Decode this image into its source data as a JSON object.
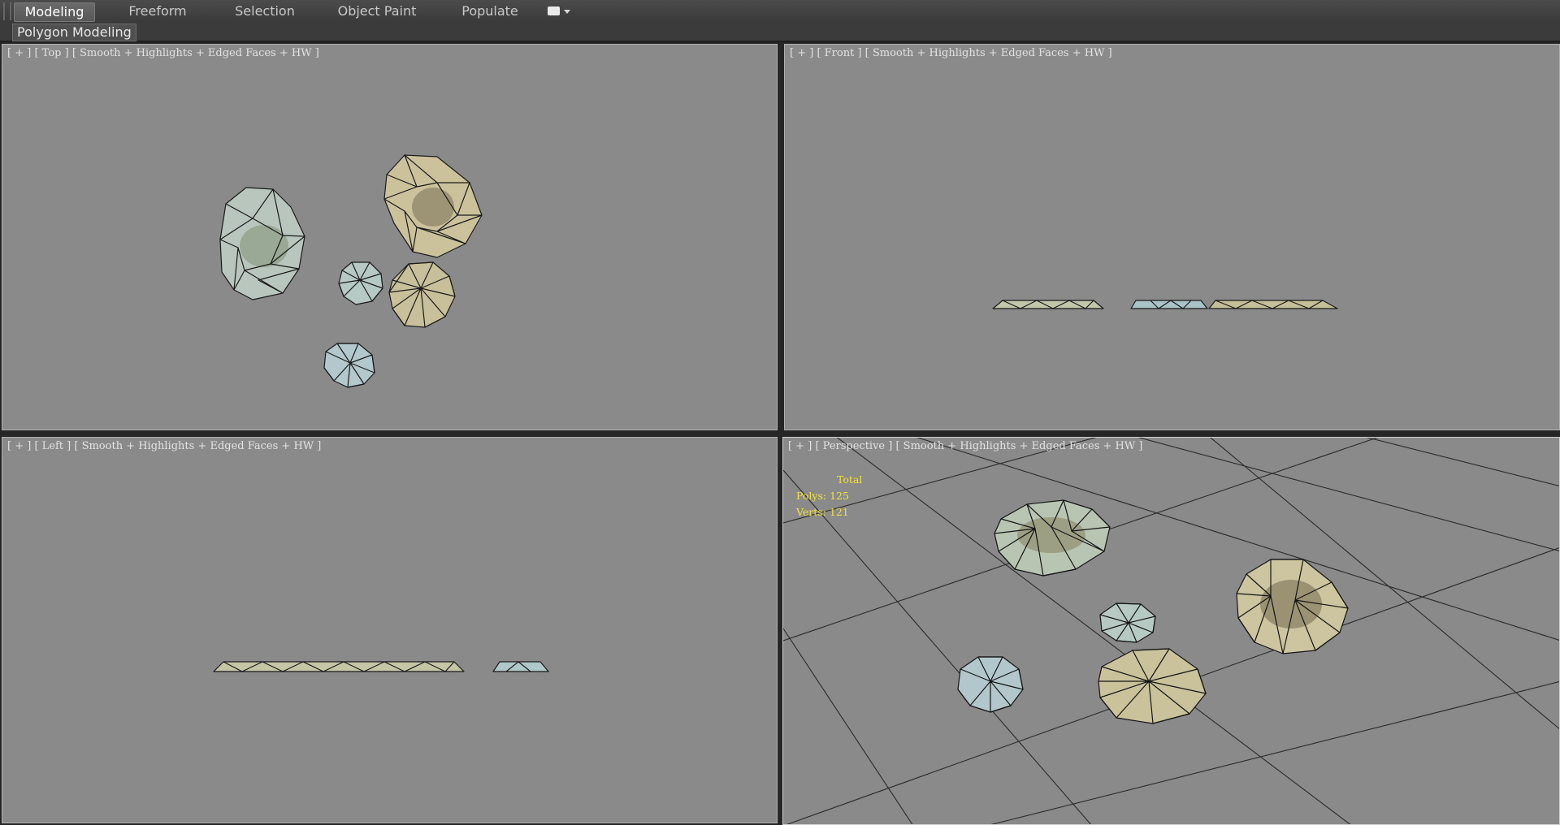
{
  "ribbon": {
    "tabs": [
      {
        "label": "Modeling",
        "active": true
      },
      {
        "label": "Freeform",
        "active": false
      },
      {
        "label": "Selection",
        "active": false
      },
      {
        "label": "Object Paint",
        "active": false
      },
      {
        "label": "Populate",
        "active": false
      }
    ],
    "options_icon": "ribbon-options-icon",
    "panel_label": "Polygon Modeling"
  },
  "viewports": {
    "top": {
      "plus": "[ + ]",
      "view": "[ Top ]",
      "shading": "[ Smooth + Highlights + Edged Faces + HW ]"
    },
    "front": {
      "plus": "[ + ]",
      "view": "[ Front ]",
      "shading": "[ Smooth + Highlights + Edged Faces + HW ]"
    },
    "left": {
      "plus": "[ + ]",
      "view": "[ Left ]",
      "shading": "[ Smooth + Highlights + Edged Faces + HW ]"
    },
    "perspective": {
      "plus": "[ + ]",
      "view": "[ Perspective ]",
      "shading": "[ Smooth + Highlights + Edged Faces + HW ]"
    }
  },
  "stats": {
    "title": "Total",
    "polys": "Polys: 125",
    "verts": "Verts: 121"
  },
  "colors": {
    "viewport_bg": "#8a8a8a",
    "stats_text": "#f2e23a",
    "stone_tan": "#c9c39c",
    "stone_blue": "#b4c8c8",
    "wire": "#1a1a1a"
  }
}
